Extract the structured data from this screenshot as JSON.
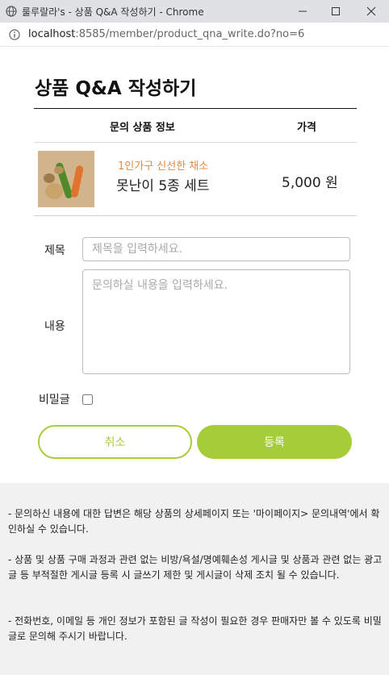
{
  "window": {
    "title": "룰루랄라's - 상품 Q&A 작성하기 - Chrome",
    "minimize_icon": "minimize-icon",
    "maximize_icon": "maximize-icon",
    "close_icon": "close-icon"
  },
  "address": {
    "host": "localhost",
    "path": ":8585/member/product_qna_write.do?no=6"
  },
  "page": {
    "title": "상품 Q&A 작성하기"
  },
  "table": {
    "col_info": "문의 상품 정보",
    "col_price": "가격"
  },
  "product": {
    "subtitle": "1인가구 신선한 채소",
    "name": "못난이 5종 세트",
    "price": "5,000 원",
    "image_icon": "vegetables-image"
  },
  "form": {
    "title_label": "제목",
    "title_placeholder": "제목을 입력하세요.",
    "content_label": "내용",
    "content_placeholder": "문의하실 내용을 입력하세요.",
    "secret_label": "비밀글",
    "cancel_label": "취소",
    "submit_label": "등록"
  },
  "notice": {
    "line1": "- 문의하신 내용에 대한 답변은 해당 상품의 상세페이지 또는 '마이페이지> 문의내역'에서 확인하실 수 있습니다.",
    "line2": "- 상품 및 상품 구매 과정과 관련 없는 비방/욕설/명예훼손성 게시글 및 상품과 관련 없는 광고글 등 부적절한 게시글 등록 시 글쓰기 제한 및 게시글이 삭제 조치 될 수 있습니다.",
    "line3": "- 전화번호, 이메일 등 개인 정보가 포함된 글 작성이 필요한 경우 판매자만 볼 수 있도록 비밀글로 문의해 주시기 바랍니다."
  },
  "colors": {
    "accent": "#a5cd39",
    "orange": "#e8893a"
  }
}
